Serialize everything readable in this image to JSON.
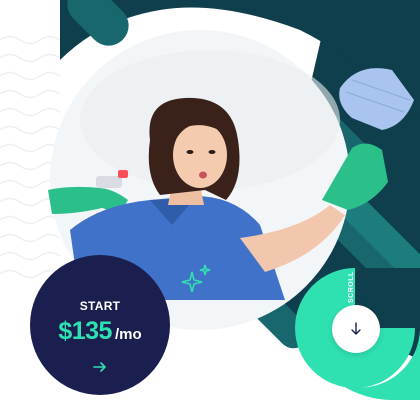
{
  "pricing": {
    "start_label": "START",
    "amount": "$135",
    "period": "/mo",
    "arrow_icon": "arrow-right-icon"
  },
  "scroll": {
    "label": "SCROLL",
    "icon": "arrow-down-icon"
  },
  "colors": {
    "dark_teal": "#0f3f4c",
    "teal": "#17676d",
    "accent_green": "#2fe0b0",
    "navy": "#1b1f4f",
    "shirt_blue": "#3f72c8",
    "glove_green": "#2bbf8a"
  }
}
